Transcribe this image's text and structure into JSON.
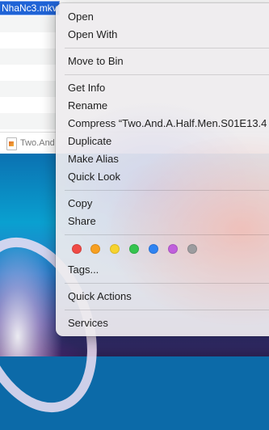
{
  "finder": {
    "selected_filename": "NhaNc3.mkv",
    "bottom_file_label": "Two.And"
  },
  "menu": {
    "open": "Open",
    "open_with": "Open With",
    "move_to_bin": "Move to Bin",
    "get_info": "Get Info",
    "rename": "Rename",
    "compress": "Compress “Two.And.A.Half.Men.S01E13.4",
    "duplicate": "Duplicate",
    "make_alias": "Make Alias",
    "quick_look": "Quick Look",
    "copy": "Copy",
    "share": "Share",
    "tags": "Tags...",
    "quick_actions": "Quick Actions",
    "services": "Services"
  },
  "tag_colors": {
    "red": "#f04a45",
    "orange": "#f7a021",
    "yellow": "#f7d32e",
    "green": "#35c44f",
    "blue": "#2f83f2",
    "purple": "#c05fdc",
    "gray": "#9c9c9f"
  }
}
